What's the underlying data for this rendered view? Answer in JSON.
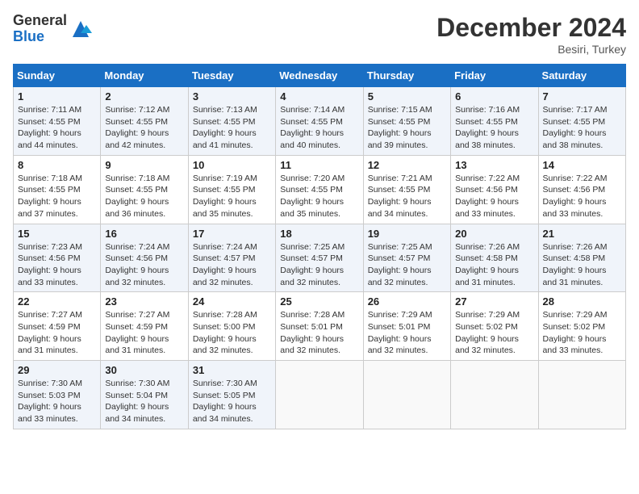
{
  "logo": {
    "general": "General",
    "blue": "Blue"
  },
  "title": "December 2024",
  "location": "Besiri, Turkey",
  "days_header": [
    "Sunday",
    "Monday",
    "Tuesday",
    "Wednesday",
    "Thursday",
    "Friday",
    "Saturday"
  ],
  "weeks": [
    [
      {
        "day": "1",
        "info": "Sunrise: 7:11 AM\nSunset: 4:55 PM\nDaylight: 9 hours\nand 44 minutes."
      },
      {
        "day": "2",
        "info": "Sunrise: 7:12 AM\nSunset: 4:55 PM\nDaylight: 9 hours\nand 42 minutes."
      },
      {
        "day": "3",
        "info": "Sunrise: 7:13 AM\nSunset: 4:55 PM\nDaylight: 9 hours\nand 41 minutes."
      },
      {
        "day": "4",
        "info": "Sunrise: 7:14 AM\nSunset: 4:55 PM\nDaylight: 9 hours\nand 40 minutes."
      },
      {
        "day": "5",
        "info": "Sunrise: 7:15 AM\nSunset: 4:55 PM\nDaylight: 9 hours\nand 39 minutes."
      },
      {
        "day": "6",
        "info": "Sunrise: 7:16 AM\nSunset: 4:55 PM\nDaylight: 9 hours\nand 38 minutes."
      },
      {
        "day": "7",
        "info": "Sunrise: 7:17 AM\nSunset: 4:55 PM\nDaylight: 9 hours\nand 38 minutes."
      }
    ],
    [
      {
        "day": "8",
        "info": "Sunrise: 7:18 AM\nSunset: 4:55 PM\nDaylight: 9 hours\nand 37 minutes."
      },
      {
        "day": "9",
        "info": "Sunrise: 7:18 AM\nSunset: 4:55 PM\nDaylight: 9 hours\nand 36 minutes."
      },
      {
        "day": "10",
        "info": "Sunrise: 7:19 AM\nSunset: 4:55 PM\nDaylight: 9 hours\nand 35 minutes."
      },
      {
        "day": "11",
        "info": "Sunrise: 7:20 AM\nSunset: 4:55 PM\nDaylight: 9 hours\nand 35 minutes."
      },
      {
        "day": "12",
        "info": "Sunrise: 7:21 AM\nSunset: 4:55 PM\nDaylight: 9 hours\nand 34 minutes."
      },
      {
        "day": "13",
        "info": "Sunrise: 7:22 AM\nSunset: 4:56 PM\nDaylight: 9 hours\nand 33 minutes."
      },
      {
        "day": "14",
        "info": "Sunrise: 7:22 AM\nSunset: 4:56 PM\nDaylight: 9 hours\nand 33 minutes."
      }
    ],
    [
      {
        "day": "15",
        "info": "Sunrise: 7:23 AM\nSunset: 4:56 PM\nDaylight: 9 hours\nand 33 minutes."
      },
      {
        "day": "16",
        "info": "Sunrise: 7:24 AM\nSunset: 4:56 PM\nDaylight: 9 hours\nand 32 minutes."
      },
      {
        "day": "17",
        "info": "Sunrise: 7:24 AM\nSunset: 4:57 PM\nDaylight: 9 hours\nand 32 minutes."
      },
      {
        "day": "18",
        "info": "Sunrise: 7:25 AM\nSunset: 4:57 PM\nDaylight: 9 hours\nand 32 minutes."
      },
      {
        "day": "19",
        "info": "Sunrise: 7:25 AM\nSunset: 4:57 PM\nDaylight: 9 hours\nand 32 minutes."
      },
      {
        "day": "20",
        "info": "Sunrise: 7:26 AM\nSunset: 4:58 PM\nDaylight: 9 hours\nand 31 minutes."
      },
      {
        "day": "21",
        "info": "Sunrise: 7:26 AM\nSunset: 4:58 PM\nDaylight: 9 hours\nand 31 minutes."
      }
    ],
    [
      {
        "day": "22",
        "info": "Sunrise: 7:27 AM\nSunset: 4:59 PM\nDaylight: 9 hours\nand 31 minutes."
      },
      {
        "day": "23",
        "info": "Sunrise: 7:27 AM\nSunset: 4:59 PM\nDaylight: 9 hours\nand 31 minutes."
      },
      {
        "day": "24",
        "info": "Sunrise: 7:28 AM\nSunset: 5:00 PM\nDaylight: 9 hours\nand 32 minutes."
      },
      {
        "day": "25",
        "info": "Sunrise: 7:28 AM\nSunset: 5:01 PM\nDaylight: 9 hours\nand 32 minutes."
      },
      {
        "day": "26",
        "info": "Sunrise: 7:29 AM\nSunset: 5:01 PM\nDaylight: 9 hours\nand 32 minutes."
      },
      {
        "day": "27",
        "info": "Sunrise: 7:29 AM\nSunset: 5:02 PM\nDaylight: 9 hours\nand 32 minutes."
      },
      {
        "day": "28",
        "info": "Sunrise: 7:29 AM\nSunset: 5:02 PM\nDaylight: 9 hours\nand 33 minutes."
      }
    ],
    [
      {
        "day": "29",
        "info": "Sunrise: 7:30 AM\nSunset: 5:03 PM\nDaylight: 9 hours\nand 33 minutes."
      },
      {
        "day": "30",
        "info": "Sunrise: 7:30 AM\nSunset: 5:04 PM\nDaylight: 9 hours\nand 34 minutes."
      },
      {
        "day": "31",
        "info": "Sunrise: 7:30 AM\nSunset: 5:05 PM\nDaylight: 9 hours\nand 34 minutes."
      },
      null,
      null,
      null,
      null
    ]
  ]
}
